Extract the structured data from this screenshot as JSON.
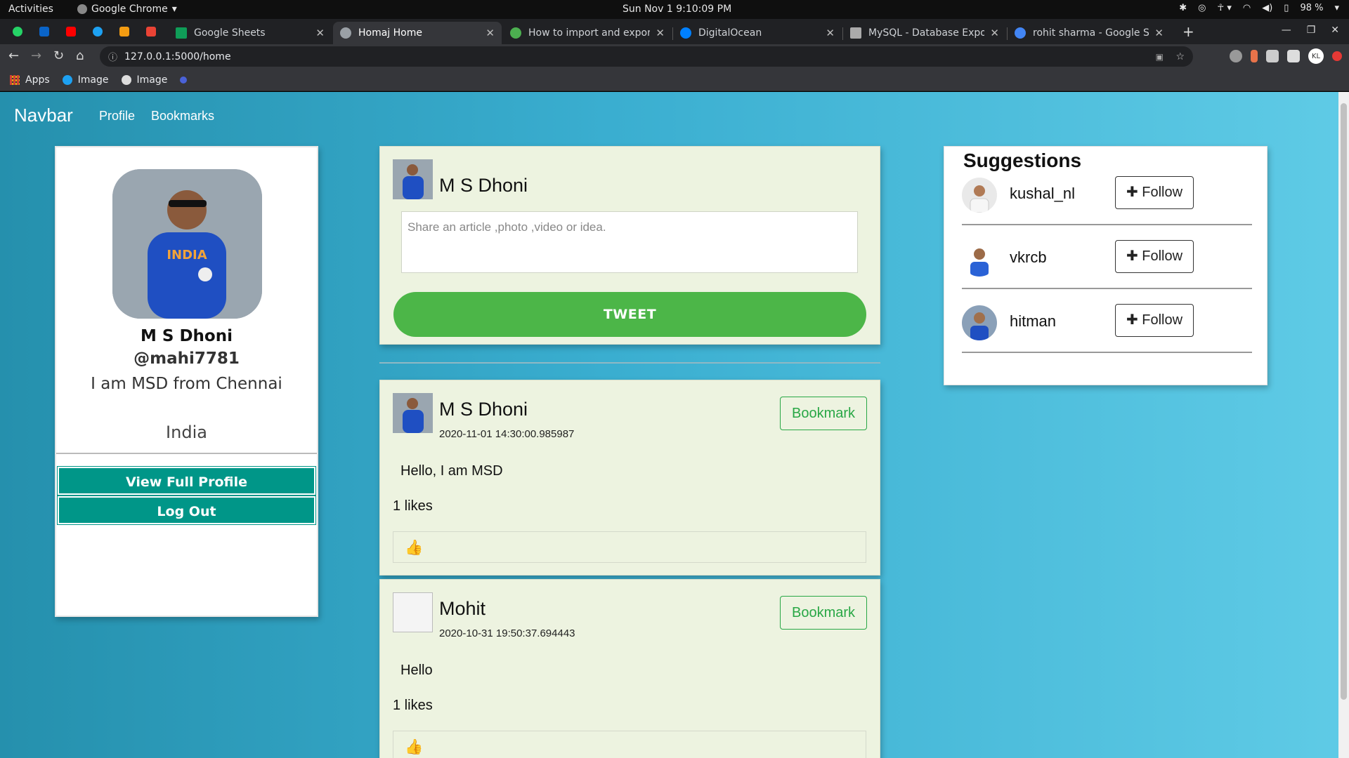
{
  "os": {
    "activities": "Activities",
    "app_name": "Google Chrome",
    "clock": "Sun Nov 1   9:10:09 PM",
    "battery": "98 %"
  },
  "tabs": [
    {
      "title": "Google Sheets",
      "active": false,
      "favicon_color": "#0f9d58"
    },
    {
      "title": "Homaj Home",
      "active": true,
      "favicon_color": "#9aa0a6"
    },
    {
      "title": "How to import and expor",
      "active": false,
      "favicon_color": "#4caf50"
    },
    {
      "title": "DigitalOcean",
      "active": false,
      "favicon_color": "#0080ff"
    },
    {
      "title": "MySQL - Database Export",
      "active": false,
      "favicon_color": "#aaaaaa"
    },
    {
      "title": "rohit sharma - Google Sea",
      "active": false,
      "favicon_color": "#4285f4"
    }
  ],
  "pinned_tabs": [
    "whatsapp-icon",
    "outlook-icon",
    "youtube-icon",
    "twitter-icon",
    "internshala-icon",
    "gmail-icon"
  ],
  "address": {
    "url": "127.0.0.1:5000/home"
  },
  "account_initials": "KL",
  "bookmarks": [
    {
      "label": "Apps",
      "icon": "apps-grid-icon"
    },
    {
      "label": "Image",
      "icon": "twitter-icon"
    },
    {
      "label": "Image",
      "icon": "globe-icon"
    }
  ],
  "navbar": {
    "brand": "Navbar",
    "links": [
      "Profile",
      "Bookmarks"
    ]
  },
  "profile": {
    "name": "M S Dhoni",
    "handle": "@mahi7781",
    "bio": "I am MSD from Chennai",
    "country": "India",
    "view_full_profile": "View Full Profile",
    "logout": "Log Out"
  },
  "compose": {
    "name": "M S Dhoni",
    "placeholder": "Share an article ,photo ,video or idea.",
    "tweet_label": "TWEET"
  },
  "posts": [
    {
      "author": "M S Dhoni",
      "timestamp": "2020-11-01 14:30:00.985987",
      "text": "Hello, I am MSD",
      "likes": "1 likes",
      "bookmark_label": "Bookmark"
    },
    {
      "author": "Mohit",
      "timestamp": "2020-10-31 19:50:37.694443",
      "text": "Hello",
      "likes": "1 likes",
      "bookmark_label": "Bookmark"
    }
  ],
  "suggestions": {
    "title": "Suggestions",
    "users": [
      {
        "username": "kushal_nl",
        "follow_label": "Follow"
      },
      {
        "username": "vkrcb",
        "follow_label": "Follow"
      },
      {
        "username": "hitman",
        "follow_label": "Follow"
      }
    ]
  },
  "colors": {
    "teal_button": "#009688",
    "tweet_green": "#4cb648",
    "bookmark_green": "#28a745",
    "card_bg": "#edf3e0"
  }
}
